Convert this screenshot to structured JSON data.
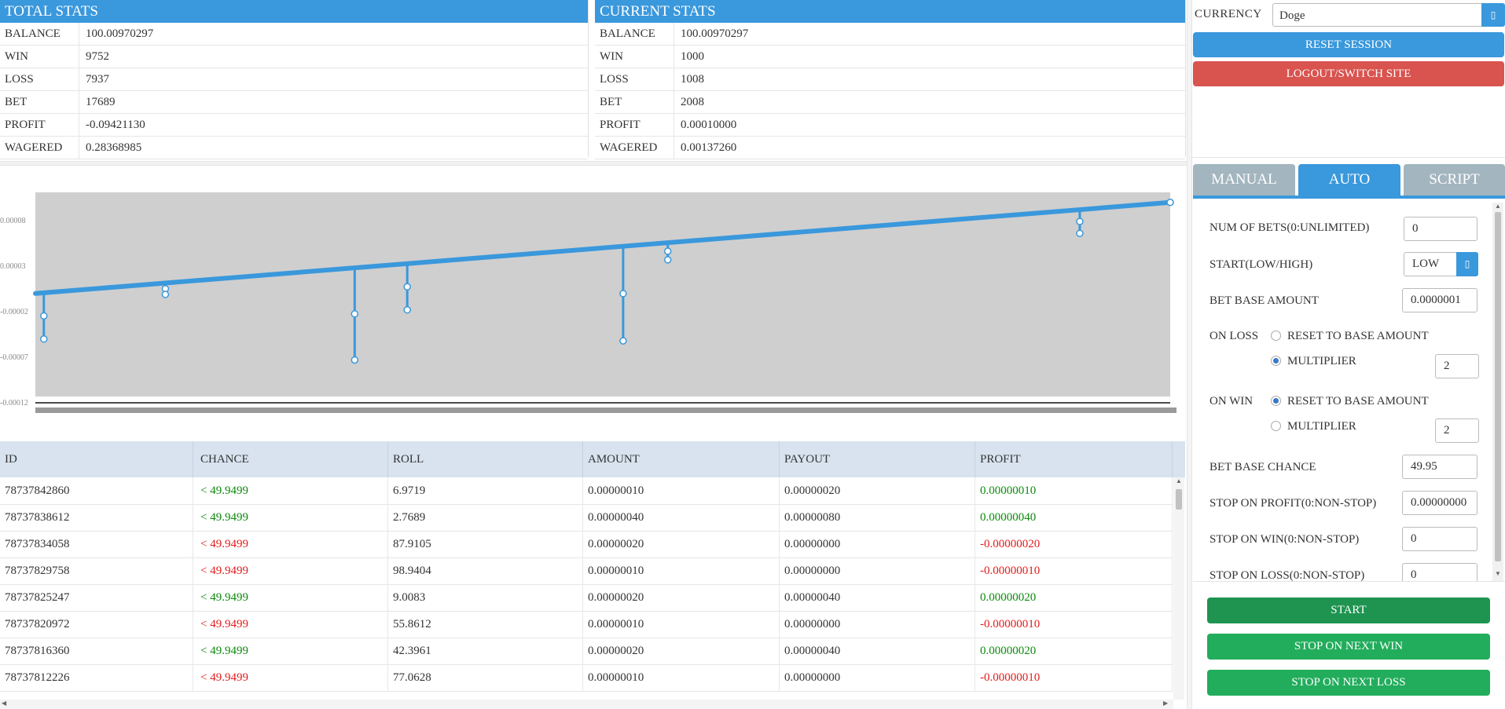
{
  "total_stats": {
    "title": "TOTAL STATS",
    "rows": [
      {
        "label": "BALANCE",
        "value": "100.00970297"
      },
      {
        "label": "WIN",
        "value": "9752"
      },
      {
        "label": "LOSS",
        "value": "7937"
      },
      {
        "label": "BET",
        "value": "17689"
      },
      {
        "label": "PROFIT",
        "value": "-0.09421130"
      },
      {
        "label": "WAGERED",
        "value": "0.28368985"
      }
    ]
  },
  "current_stats": {
    "title": "CURRENT STATS",
    "rows": [
      {
        "label": "BALANCE",
        "value": "100.00970297"
      },
      {
        "label": "WIN",
        "value": "1000"
      },
      {
        "label": "LOSS",
        "value": "1008"
      },
      {
        "label": "BET",
        "value": "2008"
      },
      {
        "label": "PROFIT",
        "value": "0.00010000"
      },
      {
        "label": "WAGERED",
        "value": "0.00137260"
      }
    ]
  },
  "currency": {
    "label": "CURRENCY",
    "value": "Doge",
    "dropdown_icon": "square-icon"
  },
  "session": {
    "reset_label": "RESET SESSION",
    "logout_label": "LOGOUT/SWITCH SITE"
  },
  "tabs": [
    {
      "label": "MANUAL",
      "active": false
    },
    {
      "label": "AUTO",
      "active": true
    },
    {
      "label": "SCRIPT",
      "active": false
    }
  ],
  "auto": {
    "num_bets_label": "NUM OF BETS(0:UNLIMITED)",
    "num_bets_value": "0",
    "start_label": "START(LOW/HIGH)",
    "start_value": "LOW",
    "base_amount_label": "BET BASE AMOUNT",
    "base_amount_value": "0.0000001",
    "on_loss_label": "ON LOSS",
    "on_loss_reset": "RESET TO BASE AMOUNT",
    "on_loss_mult": "MULTIPLIER",
    "on_loss_mult_value": "2",
    "on_win_label": "ON WIN",
    "on_win_reset": "RESET TO BASE AMOUNT",
    "on_win_mult": "MULTIPLIER",
    "on_win_mult_value": "2",
    "base_chance_label": "BET BASE CHANCE",
    "base_chance_value": "49.95",
    "stop_profit_label": "STOP ON PROFIT(0:NON-STOP)",
    "stop_profit_value": "0.00000000",
    "stop_win_label": "STOP ON WIN(0:NON-STOP)",
    "stop_win_value": "0",
    "stop_loss_label": "STOP ON LOSS(0:NON-STOP)",
    "stop_loss_value": "0"
  },
  "actions": {
    "start": "START",
    "stop_next_win": "STOP ON NEXT WIN",
    "stop_next_loss": "STOP ON NEXT LOSS"
  },
  "colors": {
    "primary": "#3a98dc",
    "danger": "#d9534f",
    "success": "#1f9a4f",
    "win": "#0a8a0a",
    "loss": "#e21b1b",
    "chart_bg": "#cfcfcf"
  },
  "chart_data": {
    "type": "line",
    "title": "",
    "xlabel": "",
    "ylabel": "",
    "y_tick_labels": [
      "0.00008",
      "0.00003",
      "-0.00002",
      "-0.00007",
      "-0.00012"
    ],
    "y_ticks": [
      8e-05,
      3e-05,
      -2e-05,
      -7e-05,
      -0.00012
    ],
    "ylim": [
      -0.00012,
      0.000111
    ],
    "xlim": [
      0,
      2008
    ],
    "trend": {
      "x": [
        0,
        2008
      ],
      "y": [
        0.0,
        0.0001
      ]
    },
    "dips": [
      {
        "x": 15,
        "y": -5e-05
      },
      {
        "x": 230,
        "y": -1e-06
      },
      {
        "x": 565,
        "y": -7.3e-05
      },
      {
        "x": 658,
        "y": -1.8e-05
      },
      {
        "x": 1040,
        "y": -5.2e-05
      },
      {
        "x": 1119,
        "y": 3.7e-05
      },
      {
        "x": 1848,
        "y": 6.6e-05
      }
    ],
    "grid": false
  },
  "bets_table": {
    "headers": [
      "ID",
      "CHANCE",
      "ROLL",
      "AMOUNT",
      "PAYOUT",
      "PROFIT"
    ],
    "rows": [
      {
        "id": "78737842860",
        "chance": "< 49.9499",
        "roll": "6.9719",
        "amount": "0.00000010",
        "payout": "0.00000020",
        "profit": "0.00000010",
        "win": true
      },
      {
        "id": "78737838612",
        "chance": "< 49.9499",
        "roll": "2.7689",
        "amount": "0.00000040",
        "payout": "0.00000080",
        "profit": "0.00000040",
        "win": true
      },
      {
        "id": "78737834058",
        "chance": "< 49.9499",
        "roll": "87.9105",
        "amount": "0.00000020",
        "payout": "0.00000000",
        "profit": "-0.00000020",
        "win": false
      },
      {
        "id": "78737829758",
        "chance": "< 49.9499",
        "roll": "98.9404",
        "amount": "0.00000010",
        "payout": "0.00000000",
        "profit": "-0.00000010",
        "win": false
      },
      {
        "id": "78737825247",
        "chance": "< 49.9499",
        "roll": "9.0083",
        "amount": "0.00000020",
        "payout": "0.00000040",
        "profit": "0.00000020",
        "win": true
      },
      {
        "id": "78737820972",
        "chance": "< 49.9499",
        "roll": "55.8612",
        "amount": "0.00000010",
        "payout": "0.00000000",
        "profit": "-0.00000010",
        "win": false
      },
      {
        "id": "78737816360",
        "chance": "< 49.9499",
        "roll": "42.3961",
        "amount": "0.00000020",
        "payout": "0.00000040",
        "profit": "0.00000020",
        "win": true
      },
      {
        "id": "78737812226",
        "chance": "< 49.9499",
        "roll": "77.0628",
        "amount": "0.00000010",
        "payout": "0.00000000",
        "profit": "-0.00000010",
        "win": false
      }
    ]
  }
}
